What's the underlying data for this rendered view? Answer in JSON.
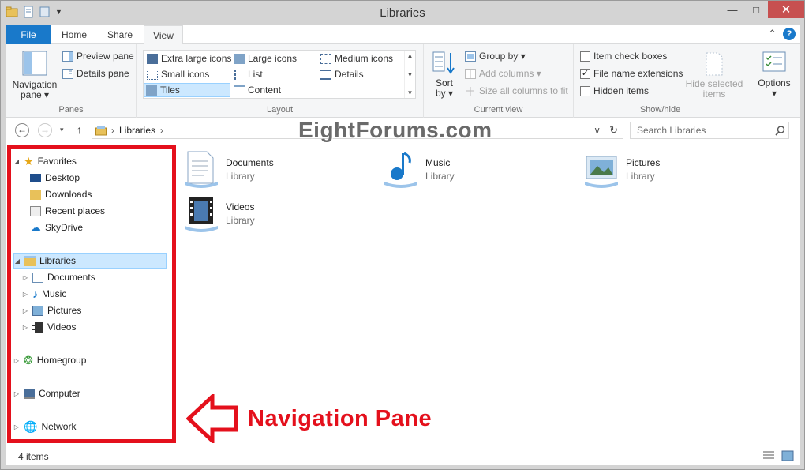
{
  "window": {
    "title": "Libraries",
    "minimize": "—",
    "maximize": "□",
    "close": "✕"
  },
  "ribbon_tabs": [
    {
      "label": "File"
    },
    {
      "label": "Home"
    },
    {
      "label": "Share"
    },
    {
      "label": "View"
    }
  ],
  "help_label": "?",
  "collapse_ribbon": "⌃",
  "panes_group": {
    "label": "Panes",
    "navigation_pane": "Navigation",
    "navigation_pane_2": "pane ▾",
    "preview_pane": "Preview pane",
    "details_pane": "Details pane"
  },
  "layout_group": {
    "label": "Layout",
    "items": [
      "Extra large icons",
      "Large icons",
      "Medium icons",
      "Small icons",
      "List",
      "Details",
      "Tiles",
      "Content"
    ],
    "selected": "Tiles"
  },
  "current_view_group": {
    "label": "Current view",
    "sort_by": "Sort",
    "sort_by_2": "by ▾",
    "group_by": "Group by ▾",
    "add_columns": "Add columns ▾",
    "size_all_columns": "Size all columns to fit"
  },
  "show_hide_group": {
    "label": "Show/hide",
    "item_check_boxes": "Item check boxes",
    "item_check_boxes_checked": false,
    "file_name_extensions": "File name extensions",
    "file_name_extensions_checked": true,
    "hidden_items": "Hidden items",
    "hidden_items_checked": false,
    "hide_selected_items": "Hide selected",
    "hide_selected_items_2": "items"
  },
  "options": {
    "label": "Options",
    "arrow": "▾"
  },
  "address_bar": {
    "back": "←",
    "forward": "→",
    "recent": "▾",
    "up": "↑",
    "crumb": "Libraries",
    "crumb_sep": "›",
    "dropdown": "∨",
    "refresh": "↻",
    "search_placeholder": "Search Libraries"
  },
  "watermark": "EightForums.com",
  "nav_pane": {
    "favorites": {
      "label": "Favorites",
      "items": [
        "Desktop",
        "Downloads",
        "Recent places",
        "SkyDrive"
      ]
    },
    "libraries": {
      "label": "Libraries",
      "items": [
        "Documents",
        "Music",
        "Pictures",
        "Videos"
      ]
    },
    "homegroup": "Homegroup",
    "computer": "Computer",
    "network": "Network"
  },
  "tiles": [
    {
      "name": "Documents",
      "type": "Library"
    },
    {
      "name": "Music",
      "type": "Library"
    },
    {
      "name": "Pictures",
      "type": "Library"
    },
    {
      "name": "Videos",
      "type": "Library"
    }
  ],
  "callout": "Navigation Pane",
  "status_bar": {
    "item_count": "4 items"
  },
  "colors": {
    "accent": "#1979ca",
    "selection": "#cce8ff",
    "callout_red": "#e4101c"
  }
}
